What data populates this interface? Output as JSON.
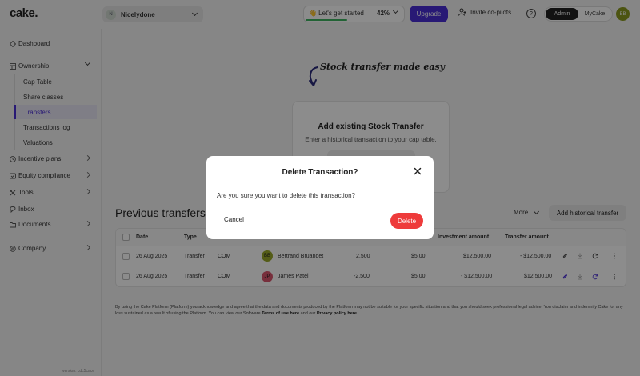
{
  "app": {
    "logo": "cake."
  },
  "topbar": {
    "company": {
      "initial": "N",
      "name": "Nicelydone"
    },
    "progress": {
      "label": "👋 Let's get started",
      "percent_text": "42%",
      "fraction": 0.42
    },
    "upgrade_label": "Upgrade",
    "invite_label": "Invite co-pilots",
    "help_glyph": "?",
    "role_switch": {
      "options": [
        "Admin",
        "MyCake"
      ],
      "active": "Admin"
    },
    "user_initials": "BB"
  },
  "sidebar": {
    "items": [
      {
        "label": "Dashboard",
        "icon": "dashboard-icon"
      },
      {
        "label": "Ownership",
        "icon": "ownership-icon",
        "expanded": true
      },
      {
        "label": "Incentive plans",
        "icon": "incentive-icon"
      },
      {
        "label": "Equity compliance",
        "icon": "compliance-icon"
      },
      {
        "label": "Tools",
        "icon": "tools-icon"
      },
      {
        "label": "Inbox",
        "icon": "inbox-icon"
      },
      {
        "label": "Documents",
        "icon": "documents-icon"
      },
      {
        "label": "Company",
        "icon": "company-icon"
      }
    ],
    "ownership_children": [
      {
        "label": "Cap Table"
      },
      {
        "label": "Share classes"
      },
      {
        "label": "Transfers",
        "active": true
      },
      {
        "label": "Transactions log"
      },
      {
        "label": "Valuations"
      }
    ],
    "version": "version: cdc5cace"
  },
  "main": {
    "hero_text": "Stock transfer made easy",
    "add_card": {
      "title": "Add existing Stock Transfer",
      "description": "Enter a historical transaction to your cap table."
    },
    "section_title": "Previous transfers",
    "more_label": "More",
    "add_historical_label": "Add historical transfer",
    "table": {
      "columns": [
        "Date",
        "Type",
        "",
        "",
        "",
        "",
        "Investment amount",
        "Transfer amount"
      ],
      "rows": [
        {
          "date": "26 Aug 2025",
          "type": "Transfer",
          "class": "COM",
          "holder_initials": "BB",
          "holder_color": "#9aa82a",
          "holder": "Bertrand Bruandet",
          "shares": "2,500",
          "price": "$5.00",
          "investment": "$12,500.00",
          "transfer": "- $12,500.00"
        },
        {
          "date": "26 Aug 2025",
          "type": "Transfer",
          "class": "COM",
          "holder_initials": "JP",
          "holder_color": "#d9566e",
          "holder": "James Patel",
          "shares": "-2,500",
          "price": "$5.00",
          "investment": "- $12,500.00",
          "transfer": "$12,500.00"
        }
      ]
    },
    "disclaimer": {
      "text": "By using the Cake Platform (Platform) you acknowledge and agree that the data and documents produced by the Platform may not be suitable for your specific situation and that you should seek professional legal advice. You disclaim and indemnify Cake for any loss sustained as a result of using the Platform. You can view our Software ",
      "terms_link": "Terms of use here",
      "mid": " and our ",
      "privacy_link": "Privacy policy here",
      "end": "."
    }
  },
  "modal": {
    "title": "Delete Transaction?",
    "message": "Are you sure you want to delete this transaction?",
    "cancel_label": "Cancel",
    "delete_label": "Delete"
  },
  "colors": {
    "accent": "#4a2fd6",
    "danger": "#ee3b3b",
    "success": "#3fb561"
  }
}
